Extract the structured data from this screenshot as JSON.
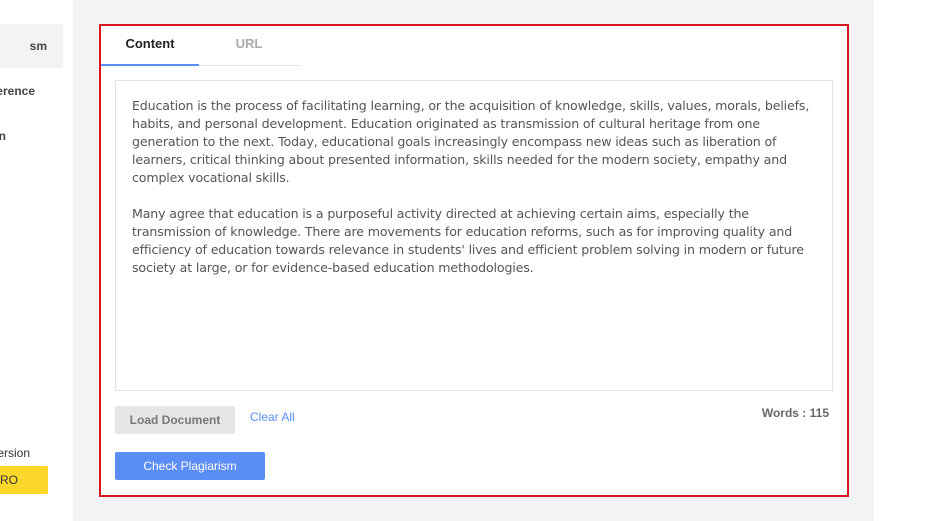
{
  "sidebar": {
    "items": [
      {
        "label": "sm"
      },
      {
        "label": "fference"
      },
      {
        "label": "son"
      }
    ],
    "version_label": "ersion",
    "pro_label": "RO"
  },
  "tabs": [
    {
      "label": "Content",
      "active": true
    },
    {
      "label": "URL",
      "active": false
    }
  ],
  "editor": {
    "paragraphs": [
      "Education is the process of facilitating learning, or the acquisition of knowledge, skills, values, morals, beliefs, habits, and personal development. Education originated as transmission of cultural heritage from one generation to the next. Today, educational goals increasingly encompass new ideas such as liberation of learners, critical thinking about presented information, skills needed for the modern society, empathy and complex vocational skills.",
      "Many agree that education is a purposeful activity directed at achieving certain aims, especially the transmission of knowledge. There are movements for education reforms, such as for improving quality and efficiency of education towards relevance in students' lives and efficient problem solving in modern or future society at large, or for evidence-based education methodologies."
    ]
  },
  "actions": {
    "load_label": "Load Document",
    "clear_label": "Clear All",
    "words_label": "Words : 115",
    "check_label": "Check Plagiarism"
  },
  "colors": {
    "accent": "#5b8df7",
    "panel_border": "#d9161f",
    "pro_yellow": "#fdd72a",
    "workspace_bg": "#f3f3f5"
  }
}
